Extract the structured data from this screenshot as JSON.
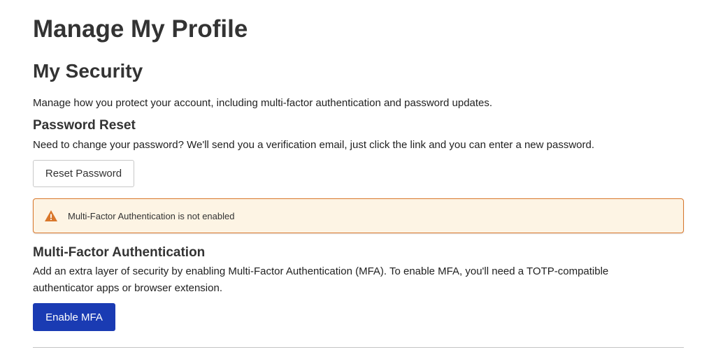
{
  "page": {
    "title": "Manage My Profile"
  },
  "security": {
    "title": "My Security",
    "description": "Manage how you protect your account, including multi-factor authentication and password updates."
  },
  "password_reset": {
    "title": "Password Reset",
    "description": "Need to change your password? We'll send you a verification email, just click the link and you can enter a new password.",
    "button_label": "Reset Password"
  },
  "alert": {
    "icon": "warning-triangle-icon",
    "text": "Multi-Factor Authentication is not enabled",
    "color": "#d9772b",
    "background": "#fdf4e4"
  },
  "mfa": {
    "title": "Multi-Factor Authentication",
    "description_line1": "Add an extra layer of security by enabling Multi-Factor Authentication (MFA). To enable MFA, you'll need a TOTP-compatible",
    "description_line2": "authenticator apps or browser extension.",
    "button_label": "Enable MFA",
    "button_color": "#1a3bb3"
  }
}
